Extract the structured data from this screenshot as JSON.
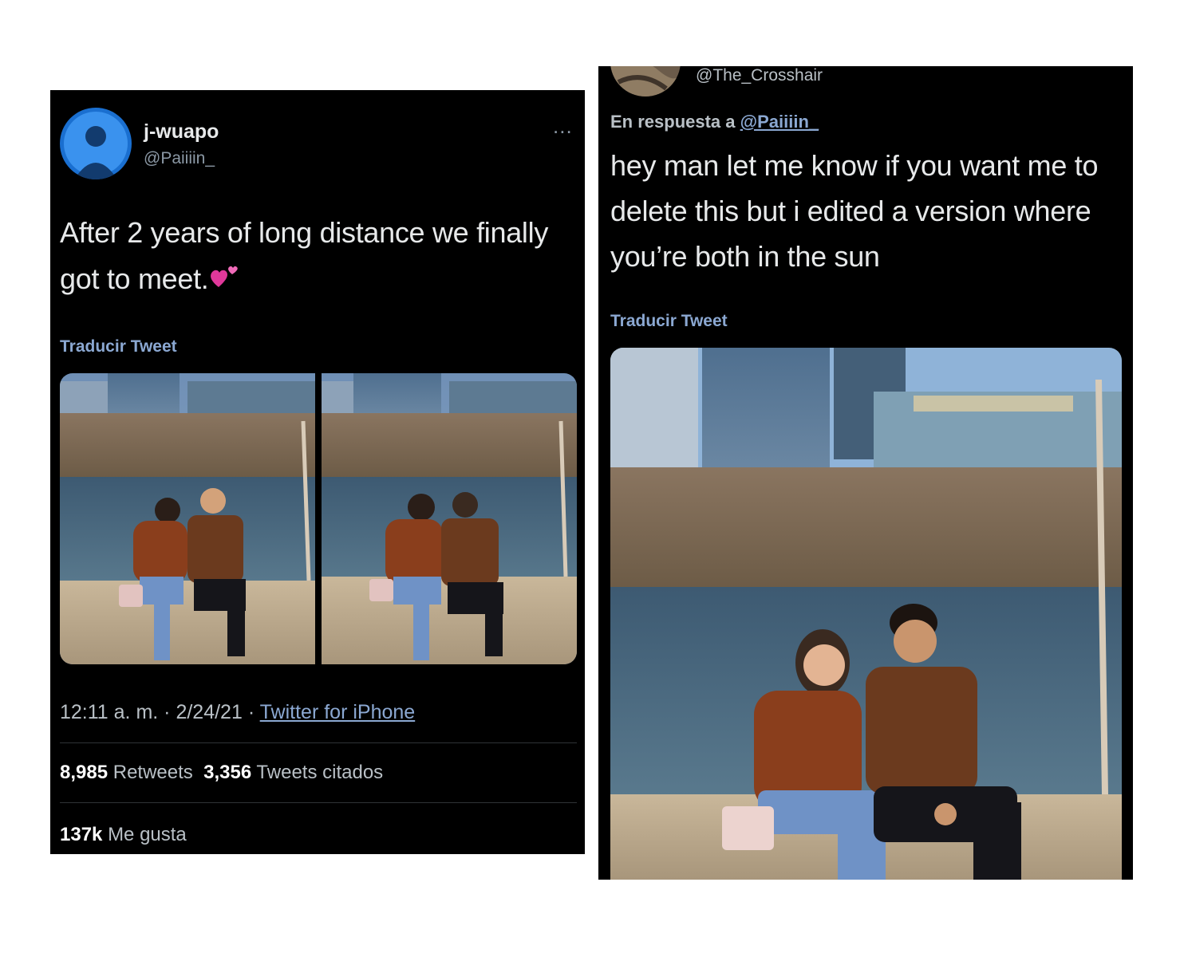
{
  "left_tweet": {
    "display_name": "j-wuapo",
    "handle": "@Paiiiin_",
    "more_label": "...",
    "text_line1": "After 2 years of long distance we finally",
    "text_line2": "got to meet.",
    "emoji": "two-hearts",
    "translate_label": "Traducir Tweet",
    "time": "12:11 a. m.",
    "separator": "·",
    "date": "2/24/21",
    "source": "Twitter for iPhone",
    "retweets_count": "8,985",
    "retweets_label": "Retweets",
    "quotes_count": "3,356",
    "quotes_label": "Tweets citados",
    "likes_count": "137k",
    "likes_label": "Me gusta",
    "photos": [
      "photo-couple-1",
      "photo-couple-2"
    ]
  },
  "right_tweet": {
    "handle": "@The_Crosshair",
    "reply_prefix": "En respuesta a",
    "reply_handle": "@Paiiiin_",
    "text_line1": "hey man let me know if you want me to",
    "text_line2": "delete this but i edited a version where",
    "text_line3": "you’re both in the sun",
    "translate_label": "Traducir Tweet",
    "photos": [
      "photo-couple-edited"
    ]
  },
  "colors": {
    "background": "#000000",
    "text": "#e7e9ea",
    "secondary": "#8b98a5",
    "link": "#8ba8d2"
  }
}
